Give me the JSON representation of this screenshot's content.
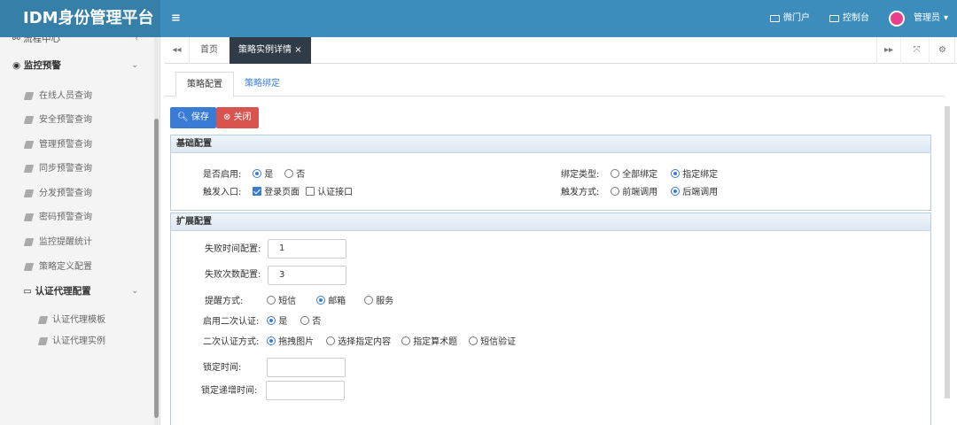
{
  "header": {
    "brand": "IDM身份管理平台",
    "micro_portal": "微门户",
    "console": "控制台",
    "user": "管理员"
  },
  "sidebar": {
    "top_partial": "流程中心",
    "group_monitor": "监控预警",
    "items": [
      "在线人员查询",
      "安全预警查询",
      "管理预警查询",
      "同步预警查询",
      "分发预警查询",
      "密码预警查询",
      "监控提醒统计",
      "策略定义配置"
    ],
    "group_proxy": "认证代理配置",
    "proxy_items": [
      "认证代理模板",
      "认证代理实例"
    ]
  },
  "tabs": {
    "home": "首页",
    "active": "策略实例详情"
  },
  "subtabs": {
    "config": "策略配置",
    "binding": "策略绑定"
  },
  "buttons": {
    "save": "保存",
    "close": "关闭"
  },
  "basic": {
    "title": "基础配置",
    "enabled_label": "是否启用:",
    "yes": "是",
    "no": "否",
    "entry_label": "触发入口:",
    "entry_login": "登录页面",
    "entry_auth": "认证接口",
    "bind_label": "绑定类型:",
    "bind_all": "全部绑定",
    "bind_specific": "指定绑定",
    "trigger_label": "触发方式:",
    "trigger_pre": "前端调用",
    "trigger_post": "后端调用"
  },
  "ext": {
    "title": "扩展配置",
    "fail_time_label": "失败时间配置:",
    "fail_time_value": "1",
    "fail_count_label": "失败次数配置:",
    "fail_count_value": "3",
    "remind_label": "提醒方式:",
    "remind_sms": "短信",
    "remind_mail": "邮箱",
    "remind_service": "服务",
    "second_label": "启用二次认证:",
    "second_yes": "是",
    "second_no": "否",
    "second_mode_label": "二次认证方式:",
    "mode_drag": "拖拽图片",
    "mode_text": "选择指定内容",
    "mode_math": "指定算术题",
    "mode_sms": "短信验证",
    "lock_label": "锁定时间:",
    "lock_inc_label": "锁定递增时间:"
  },
  "colors": {
    "header": "#3c8dbc",
    "brand_bg": "#367fa9",
    "save": "#3a7bd5",
    "close": "#d9534f"
  }
}
